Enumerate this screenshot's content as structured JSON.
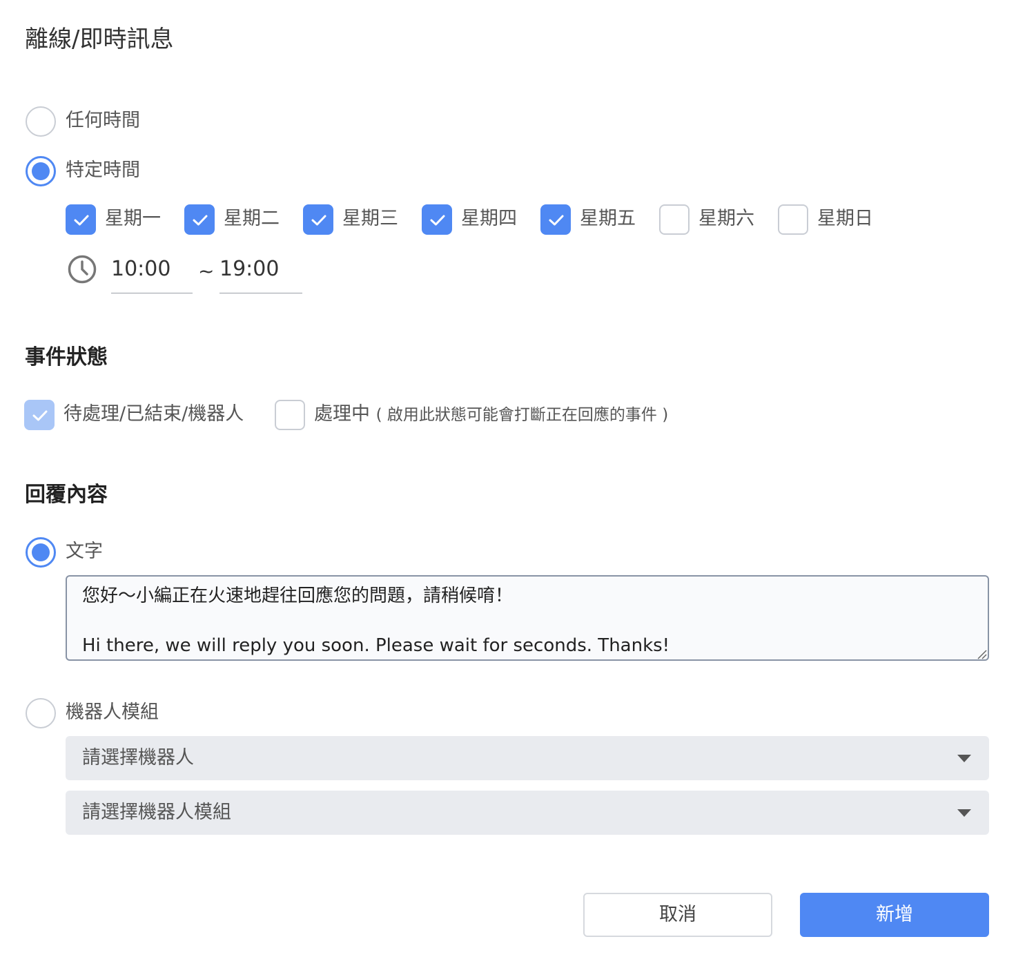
{
  "page_title": "離線/即時訊息",
  "schedule": {
    "any_time_label": "任何時間",
    "specific_time_label": "特定時間",
    "selected": "specific",
    "days": [
      {
        "label": "星期一",
        "checked": true
      },
      {
        "label": "星期二",
        "checked": true
      },
      {
        "label": "星期三",
        "checked": true
      },
      {
        "label": "星期四",
        "checked": true
      },
      {
        "label": "星期五",
        "checked": true
      },
      {
        "label": "星期六",
        "checked": false
      },
      {
        "label": "星期日",
        "checked": false
      }
    ],
    "start_time": "10:00",
    "separator": "~",
    "end_time": "19:00"
  },
  "event_status": {
    "title": "事件狀態",
    "pending_label": "待處理/已結束/機器人",
    "pending_checked": true,
    "pending_disabled": true,
    "processing_label": "處理中",
    "processing_hint": "( 啟用此狀態可能會打斷正在回應的事件 )",
    "processing_checked": false
  },
  "reply": {
    "title": "回覆內容",
    "text_label": "文字",
    "selected": "text",
    "text_value": "您好～小編正在火速地趕往回應您的問題，請稍候唷！\n\nHi there, we will reply you soon. Please wait for seconds. Thanks!",
    "bot_label": "機器人模組",
    "bot_select_placeholder": "請選擇機器人",
    "bot_module_select_placeholder": "請選擇機器人模組"
  },
  "actions": {
    "cancel_label": "取消",
    "add_label": "新增"
  },
  "colors": {
    "accent": "#4f88f3",
    "accent_disabled": "#a9c6f7",
    "select_bg": "#e9ebef"
  }
}
